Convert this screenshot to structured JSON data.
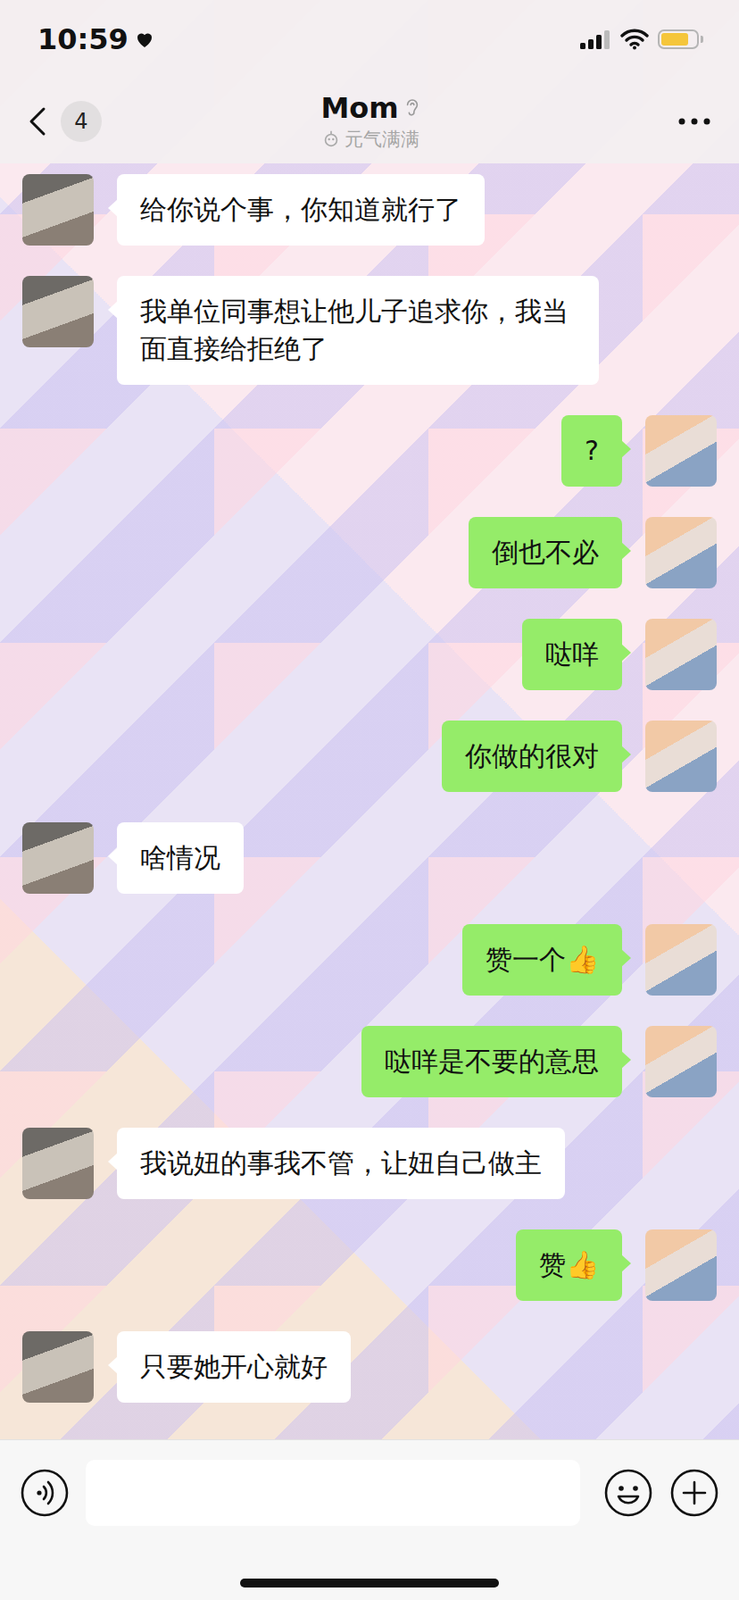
{
  "status_bar": {
    "time": "10:59",
    "battery": {
      "level": 0.8,
      "color": "#f5c63b"
    }
  },
  "header": {
    "back_badge": "4",
    "title": "Mom",
    "subtitle": "元气满满"
  },
  "messages": [
    {
      "side": "left",
      "text": "给你说个事，你知道就行了"
    },
    {
      "side": "left",
      "text": "我单位同事想让他儿子追求你，我当面直接给拒绝了"
    },
    {
      "side": "right",
      "text": "?"
    },
    {
      "side": "right",
      "text": "倒也不必"
    },
    {
      "side": "right",
      "text": "哒咩"
    },
    {
      "side": "right",
      "text": "你做的很对"
    },
    {
      "side": "left",
      "text": "啥情况"
    },
    {
      "side": "right",
      "text": "赞一个👍"
    },
    {
      "side": "right",
      "text": "哒咩是不要的意思"
    },
    {
      "side": "left",
      "text": "我说妞的事我不管，让妞自己做主"
    },
    {
      "side": "right",
      "text": "赞👍"
    },
    {
      "side": "left",
      "text": "只要她开心就好"
    }
  ]
}
